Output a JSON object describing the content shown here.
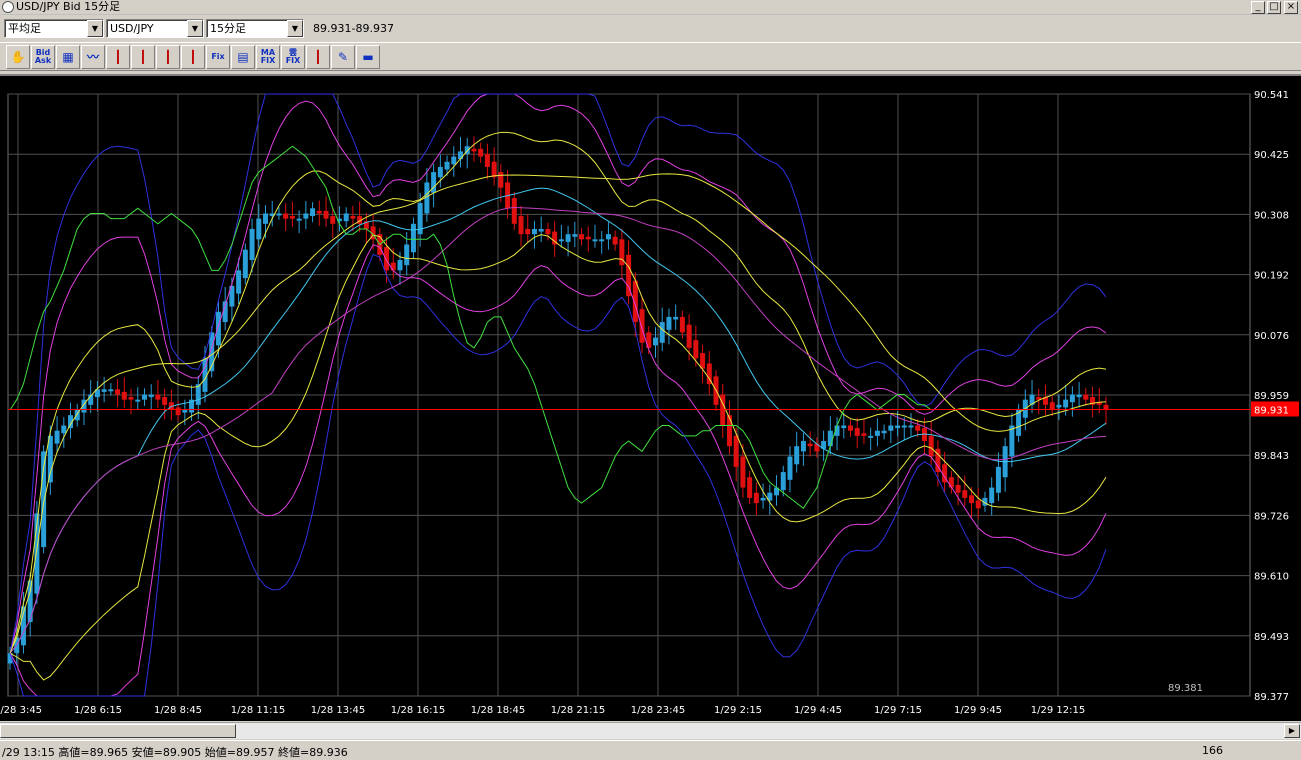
{
  "window": {
    "title": "USD/JPY Bid 15分足",
    "minimize": "_",
    "maximize": "□",
    "close": "×"
  },
  "controls": {
    "candle_type": "平均足",
    "symbol": "USD/JPY",
    "timeframe": "15分足",
    "quote": "89.931-89.937"
  },
  "toolbar": {
    "buttons": [
      {
        "icon": "hand-icon",
        "label": ""
      },
      {
        "icon": "bid-ask-icon",
        "label": "Bid Ask"
      },
      {
        "icon": "indicator-icon",
        "label": ""
      },
      {
        "icon": "line-chart-icon",
        "label": ""
      },
      {
        "icon": "candle-icon",
        "label": ""
      },
      {
        "icon": "candle-icon",
        "label": ""
      },
      {
        "icon": "candle-icon",
        "label": ""
      },
      {
        "icon": "candle-icon",
        "label": ""
      },
      {
        "icon": "fix-icon",
        "label": "Fix"
      },
      {
        "icon": "grid-icon",
        "label": ""
      },
      {
        "icon": "ma-fix-icon",
        "label": "MA FIX"
      },
      {
        "icon": "ichimoku-fix-icon",
        "label": "雲 FIX"
      },
      {
        "icon": "candle-icon",
        "label": ""
      },
      {
        "icon": "pen-icon",
        "label": ""
      },
      {
        "icon": "print-icon",
        "label": ""
      }
    ]
  },
  "chart_data": {
    "type": "candlestick",
    "y_ticks": [
      "90.541",
      "90.425",
      "90.308",
      "90.192",
      "90.076",
      "89.959",
      "89.843",
      "89.726",
      "89.610",
      "89.493",
      "89.377"
    ],
    "ylim": [
      89.377,
      90.541
    ],
    "x_ticks": [
      "1/28 3:45",
      "1/28 6:15",
      "1/28 8:45",
      "1/28 11:15",
      "1/28 13:45",
      "1/28 16:15",
      "1/28 18:45",
      "1/28 21:15",
      "1/28 23:45",
      "1/29 2:15",
      "1/29 4:45",
      "1/29 7:15",
      "1/29 9:45",
      "1/29 12:15"
    ],
    "current_price": 89.931,
    "current_price_label": "89.931",
    "low_label": "89.381",
    "colors": {
      "up": "#2a9fd8",
      "down": "#e01010",
      "price_line": "#ff0000",
      "grid": "#505050"
    },
    "closes": [
      89.46,
      89.49,
      89.55,
      89.6,
      89.73,
      89.85,
      89.88,
      89.89,
      89.9,
      89.92,
      89.93,
      89.95,
      89.96,
      89.97,
      89.97,
      89.97,
      89.96,
      89.95,
      89.95,
      89.95,
      89.96,
      89.96,
      89.95,
      89.94,
      89.93,
      89.92,
      89.93,
      89.95,
      89.98,
      90.03,
      90.08,
      90.12,
      90.14,
      90.17,
      90.2,
      90.24,
      90.28,
      90.3,
      90.31,
      90.31,
      90.31,
      90.3,
      90.3,
      90.3,
      90.31,
      90.32,
      90.31,
      90.3,
      90.29,
      90.3,
      90.31,
      90.3,
      90.29,
      90.28,
      90.26,
      90.23,
      90.2,
      90.2,
      90.22,
      90.25,
      90.29,
      90.33,
      90.37,
      90.39,
      90.4,
      90.41,
      90.42,
      90.43,
      90.44,
      90.43,
      90.42,
      90.4,
      90.38,
      90.36,
      90.32,
      90.29,
      90.27,
      90.27,
      90.28,
      90.28,
      90.27,
      90.25,
      90.26,
      90.27,
      90.27,
      90.26,
      90.26,
      90.26,
      90.26,
      90.27,
      90.25,
      90.21,
      90.15,
      90.1,
      90.06,
      90.05,
      90.07,
      90.1,
      90.11,
      90.11,
      90.08,
      90.05,
      90.03,
      90.01,
      89.98,
      89.94,
      89.9,
      89.86,
      89.82,
      89.78,
      89.76,
      89.75,
      89.76,
      89.77,
      89.78,
      89.81,
      89.84,
      89.86,
      89.87,
      89.86,
      89.85,
      89.87,
      89.89,
      89.9,
      89.9,
      89.89,
      89.88,
      89.88,
      89.88,
      89.89,
      89.89,
      89.9,
      89.9,
      89.9,
      89.9,
      89.89,
      89.87,
      89.84,
      89.81,
      89.79,
      89.78,
      89.77,
      89.76,
      89.75,
      89.74,
      89.76,
      89.78,
      89.82,
      89.86,
      89.9,
      89.93,
      89.95,
      89.96,
      89.95,
      89.94,
      89.93,
      89.94,
      89.95,
      89.96,
      89.96,
      89.95,
      89.94,
      89.94,
      89.93
    ]
  },
  "status": {
    "text": "/29 13:15  高値=89.965 安値=89.905 始値=89.957 終値=89.936",
    "count": "166"
  }
}
